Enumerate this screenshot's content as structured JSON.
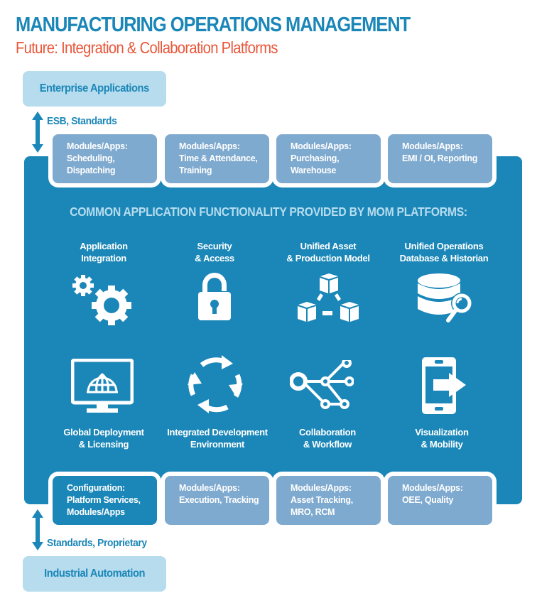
{
  "header": {
    "title": "MANUFACTURING OPERATIONS MANAGEMENT",
    "subtitle": "Future: Integration & Collaboration Platforms"
  },
  "colors": {
    "primary_blue": "#1b87b8",
    "accent_orange": "#e9573a",
    "light_blue": "#b6dcee",
    "module_blue": "#7faacf",
    "white": "#ffffff"
  },
  "top_endpoint": {
    "label": "Enterprise Applications",
    "link_label": "ESB, Standards",
    "link_icon": "double-arrow-vertical"
  },
  "bottom_endpoint": {
    "label": "Industrial Automation",
    "link_label": "Standards, Proprietary",
    "link_icon": "double-arrow-vertical"
  },
  "top_modules": [
    {
      "heading": "Modules/Apps:",
      "body": "Scheduling,\nDispatching"
    },
    {
      "heading": "Modules/Apps:",
      "body": "Time & Attendance,\nTraining"
    },
    {
      "heading": "Modules/Apps:",
      "body": "Purchasing,\nWarehouse"
    },
    {
      "heading": "Modules/Apps:",
      "body": "EMI / OI, Reporting"
    }
  ],
  "bottom_modules": [
    {
      "heading": "Configuration:",
      "body": "Platform Services,\nModules/Apps",
      "style": "dark"
    },
    {
      "heading": "Modules/Apps:",
      "body": "Execution, Tracking"
    },
    {
      "heading": "Modules/Apps:",
      "body": "Asset Tracking,\nMRO, RCM"
    },
    {
      "heading": "Modules/Apps:",
      "body": "OEE, Quality"
    }
  ],
  "panel": {
    "heading": "COMMON APPLICATION FUNCTIONALITY PROVIDED BY MOM PLATFORMS:",
    "features_top": [
      {
        "label": "Application\nIntegration",
        "icon": "gears-icon"
      },
      {
        "label": "Security\n& Access",
        "icon": "padlock-icon"
      },
      {
        "label": "Unified Asset\n& Production Model",
        "icon": "cubes-icon"
      },
      {
        "label": "Unified Operations\nDatabase & Historian",
        "icon": "database-search-icon"
      }
    ],
    "features_bottom": [
      {
        "label": "Global Deployment\n& Licensing",
        "icon": "monitor-globe-icon"
      },
      {
        "label": "Integrated Development\nEnvironment",
        "icon": "cycle-arrows-icon"
      },
      {
        "label": "Collaboration\n& Workflow",
        "icon": "workflow-network-icon"
      },
      {
        "label": "Visualization\n& Mobility",
        "icon": "mobile-arrow-icon"
      }
    ]
  }
}
